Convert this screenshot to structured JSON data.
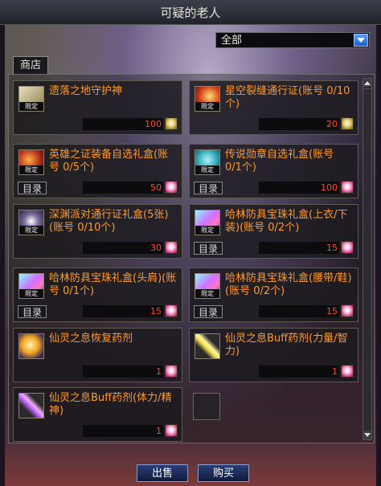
{
  "window": {
    "title": "可疑的老人"
  },
  "filter": {
    "selected": "全部"
  },
  "tab": {
    "label": "商店"
  },
  "items": [
    {
      "name": "遗落之地守护神",
      "catalog": "",
      "price": "100",
      "limit": "限定",
      "coin": "gold"
    },
    {
      "name": "星空裂缝通行证(账号 0/10个)",
      "catalog": "",
      "price": "20",
      "limit": "限定",
      "coin": "gold"
    },
    {
      "name": "英雄之证装备自选礼盒(账号 0/5个)",
      "catalog": "目录",
      "price": "50",
      "limit": "限定",
      "coin": "pink"
    },
    {
      "name": "传说勋章自选礼盒(账号 0/1个)",
      "catalog": "目录",
      "price": "100",
      "limit": "限定",
      "coin": "pink"
    },
    {
      "name": "深渊派对通行证礼盒(5张)(账号 0/10个)",
      "catalog": "",
      "price": "30",
      "limit": "限定",
      "coin": "pink"
    },
    {
      "name": "哈林防具宝珠礼盒(上衣/下装)(账号 0/2个)",
      "catalog": "目录",
      "price": "15",
      "limit": "限定",
      "coin": "pink"
    },
    {
      "name": "哈林防具宝珠礼盒(头肩)(账号 0/1个)",
      "catalog": "目录",
      "price": "15",
      "limit": "限定",
      "coin": "pink"
    },
    {
      "name": "哈林防具宝珠礼盒(腰带/鞋)(账号 0/2个)",
      "catalog": "目录",
      "price": "15",
      "limit": "限定",
      "coin": "pink"
    },
    {
      "name": "仙灵之息恢复药剂",
      "catalog": "",
      "price": "1",
      "limit": "",
      "coin": "pink"
    },
    {
      "name": "仙灵之息Buff药剂(力量/智力)",
      "catalog": "",
      "price": "1",
      "limit": "",
      "coin": "pink"
    },
    {
      "name": "仙灵之息Buff药剂(体力/精神)",
      "catalog": "",
      "price": "1",
      "limit": "",
      "coin": "pink"
    }
  ],
  "buttons": {
    "sell": "出售",
    "buy": "购买"
  }
}
